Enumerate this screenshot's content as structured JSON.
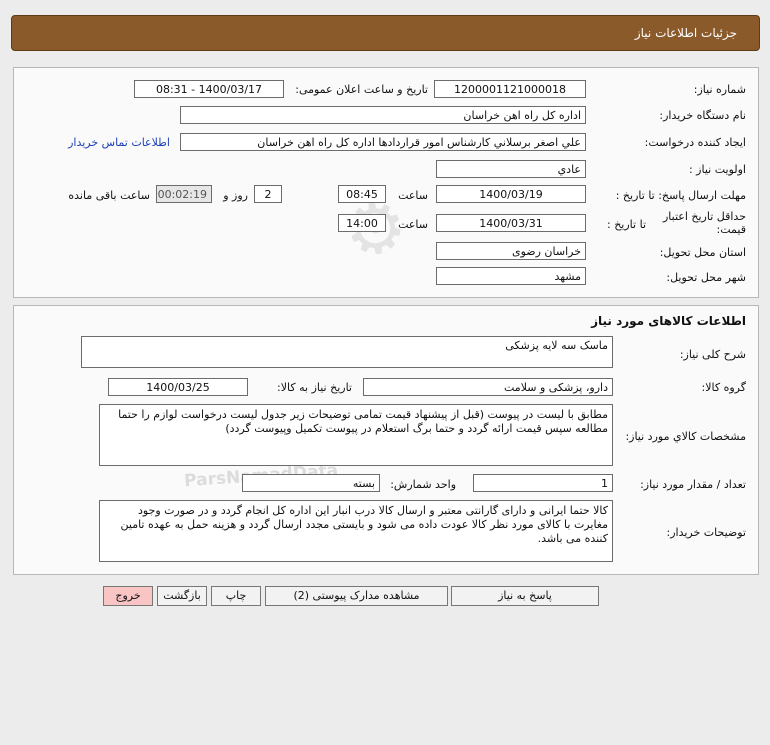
{
  "header": {
    "title": "جزئیات اطلاعات نیاز"
  },
  "info": {
    "need_number_label": "شماره نیاز:",
    "need_number": "1200001121000018",
    "announce_label": "تاریخ و ساعت اعلان عمومی:",
    "announce_value": "1400/03/17 - 08:31",
    "buyer_label": "نام دستگاه خریدار:",
    "buyer_value": "اداره کل راه اهن خراسان",
    "creator_label": "ایجاد کننده درخواست:",
    "creator_value": "علي اصغر برسلاني کارشناس امور قراردادها اداره کل راه اهن خراسان",
    "contact_link": "اطلاعات تماس خریدار",
    "priority_label": "اولویت نیاز :",
    "priority_value": "عادي",
    "deadline_label": "مهلت ارسال پاسخ: تا تاریخ :",
    "deadline_date": "1400/03/19",
    "time_label": "ساعت",
    "deadline_time": "08:45",
    "days_value": "2",
    "days_label": "روز و",
    "remaining_value": "00:02:19",
    "remaining_label": "ساعت باقی مانده",
    "validity_label": "حداقل تاریخ اعتبار قیمت:",
    "validity_sub_label": "تا تاریخ :",
    "validity_date": "1400/03/31",
    "validity_time_label": "ساعت",
    "validity_time": "14:00",
    "province_label": "استان محل تحویل:",
    "province_value": "خراسان رضوی",
    "city_label": "شهر محل تحویل:",
    "city_value": "مشهد"
  },
  "goods": {
    "section_title": "اطلاعات کالاهای مورد نیاز",
    "desc_label": "شرح کلی نیاز:",
    "desc_value": "ماسک سه لایه پزشکی",
    "group_label": "گروه کالا:",
    "group_value": "دارو، پزشکی و سلامت",
    "need_date_label": "تاریخ نیاز به کالا:",
    "need_date_value": "1400/03/25",
    "spec_label": "مشخصات کالاي مورد نیاز:",
    "spec_value": "مطابق با لیست در پیوست (قبل از پیشنهاد قیمت تمامی توضیحات زیر جدول لیست درخواست لوازم را حتما مطالعه سپس قیمت ارائه گردد  و حتما برگ استعلام در پیوست تکمیل وپیوست گردد)",
    "qty_label": "تعداد / مقدار مورد نیاز:",
    "qty_value": "1",
    "unit_label": "واحد شمارش:",
    "unit_value": "بسته",
    "buyer_desc_label": "توضیحات خریدار:",
    "buyer_desc_value": "کالا حتما ایرانی و دارای گارانتی معتبر و ارسال کالا درب انبار این اداره کل انجام گردد و در صورت وجود مغایرت با کالای مورد نظر کالا عودت داده می شود و بایستی مجدد ارسال گردد و هزینه حمل به عهده تامین کننده می باشد."
  },
  "buttons": {
    "reply": "پاسخ به نیاز",
    "attachments": "مشاهده مدارک پیوستی (2)",
    "print": "چاپ",
    "back": "بازگشت",
    "exit": "خروج"
  },
  "colors": {
    "header_bg": "#8b5a2b",
    "exit_bg": "#f8c4c4",
    "link": "#1d3fb8"
  }
}
